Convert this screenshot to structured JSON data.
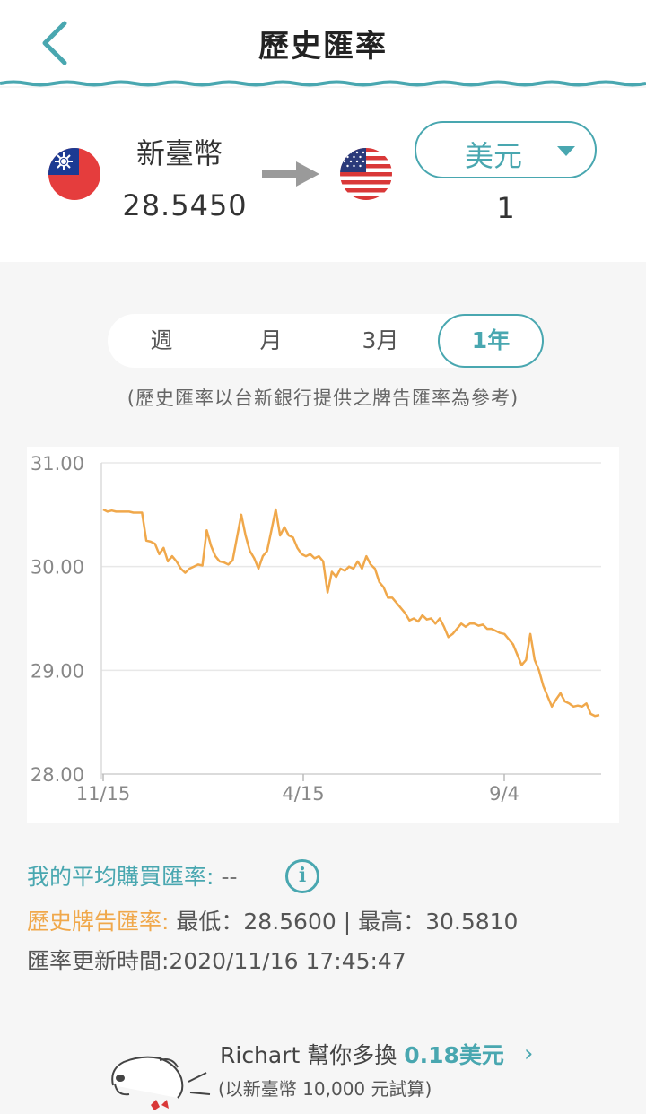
{
  "header": {
    "title": "歷史匯率",
    "back_icon": "chevron-left-icon",
    "accent": "#49a7b0"
  },
  "converter": {
    "from_currency": "新臺幣",
    "from_amount": "28.5450",
    "to_currency": "美元",
    "to_amount": "1",
    "arrow_icon": "arrow-right-icon"
  },
  "tabs": [
    {
      "label": "週",
      "active": false
    },
    {
      "label": "月",
      "active": false
    },
    {
      "label": "3月",
      "active": false
    },
    {
      "label": "1年",
      "active": true
    }
  ],
  "note": "(歷史匯率以台新銀行提供之牌告匯率為參考)",
  "chart_data": {
    "type": "line",
    "x_tick_labels": [
      "11/15",
      "4/15",
      "9/4"
    ],
    "y_tick_labels": [
      "31.00",
      "30.00",
      "29.00",
      "28.00"
    ],
    "ylim": [
      28,
      31
    ],
    "grid": true,
    "line_color": "#f0a84b",
    "series": [
      {
        "values": [
          30.55,
          30.53,
          30.54,
          30.53,
          30.53,
          30.53,
          30.53,
          30.52,
          30.52,
          30.52,
          30.25,
          30.24,
          30.22,
          30.12,
          30.18,
          30.05,
          30.1,
          30.05,
          29.98,
          29.94,
          29.98,
          30.0,
          30.02,
          30.01,
          30.35,
          30.2,
          30.1,
          30.05,
          30.04,
          30.02,
          30.06,
          30.28,
          30.5,
          30.3,
          30.15,
          30.08,
          29.98,
          30.1,
          30.15,
          30.35,
          30.55,
          30.3,
          30.38,
          30.3,
          30.28,
          30.18,
          30.12,
          30.1,
          30.12,
          30.08,
          30.1,
          30.05,
          29.75,
          29.95,
          29.9,
          29.98,
          29.96,
          30.0,
          29.98,
          30.05,
          29.98,
          30.1,
          30.02,
          29.98,
          29.85,
          29.8,
          29.7,
          29.7,
          29.65,
          29.6,
          29.55,
          29.48,
          29.5,
          29.47,
          29.53,
          29.49,
          29.5,
          29.45,
          29.5,
          29.42,
          29.32,
          29.35,
          29.4,
          29.45,
          29.42,
          29.45,
          29.45,
          29.43,
          29.44,
          29.4,
          29.4,
          29.38,
          29.36,
          29.35,
          29.3,
          29.25,
          29.15,
          29.05,
          29.1,
          29.35,
          29.1,
          29.0,
          28.85,
          28.75,
          28.65,
          28.72,
          28.78,
          28.7,
          28.68,
          28.65,
          28.66,
          28.65,
          28.68,
          28.58,
          28.56,
          28.57
        ]
      }
    ]
  },
  "stats": {
    "avg_label": "我的平均購買匯率:",
    "avg_value": "--",
    "info_icon": "info-icon",
    "hist_label": "歷史牌告匯率:",
    "hist_value": " 最低：28.5600 | 最高：30.5810",
    "update_text": "匯率更新時間:2020/11/16 17:45:47"
  },
  "promo": {
    "prefix": "Richart 幫你多換 ",
    "amount": "0.18美元",
    "chevron_icon": "chevron-right-icon",
    "sub": "(以新臺幣 10,000 元試算)",
    "mascot": "dog-mascot-icon"
  }
}
